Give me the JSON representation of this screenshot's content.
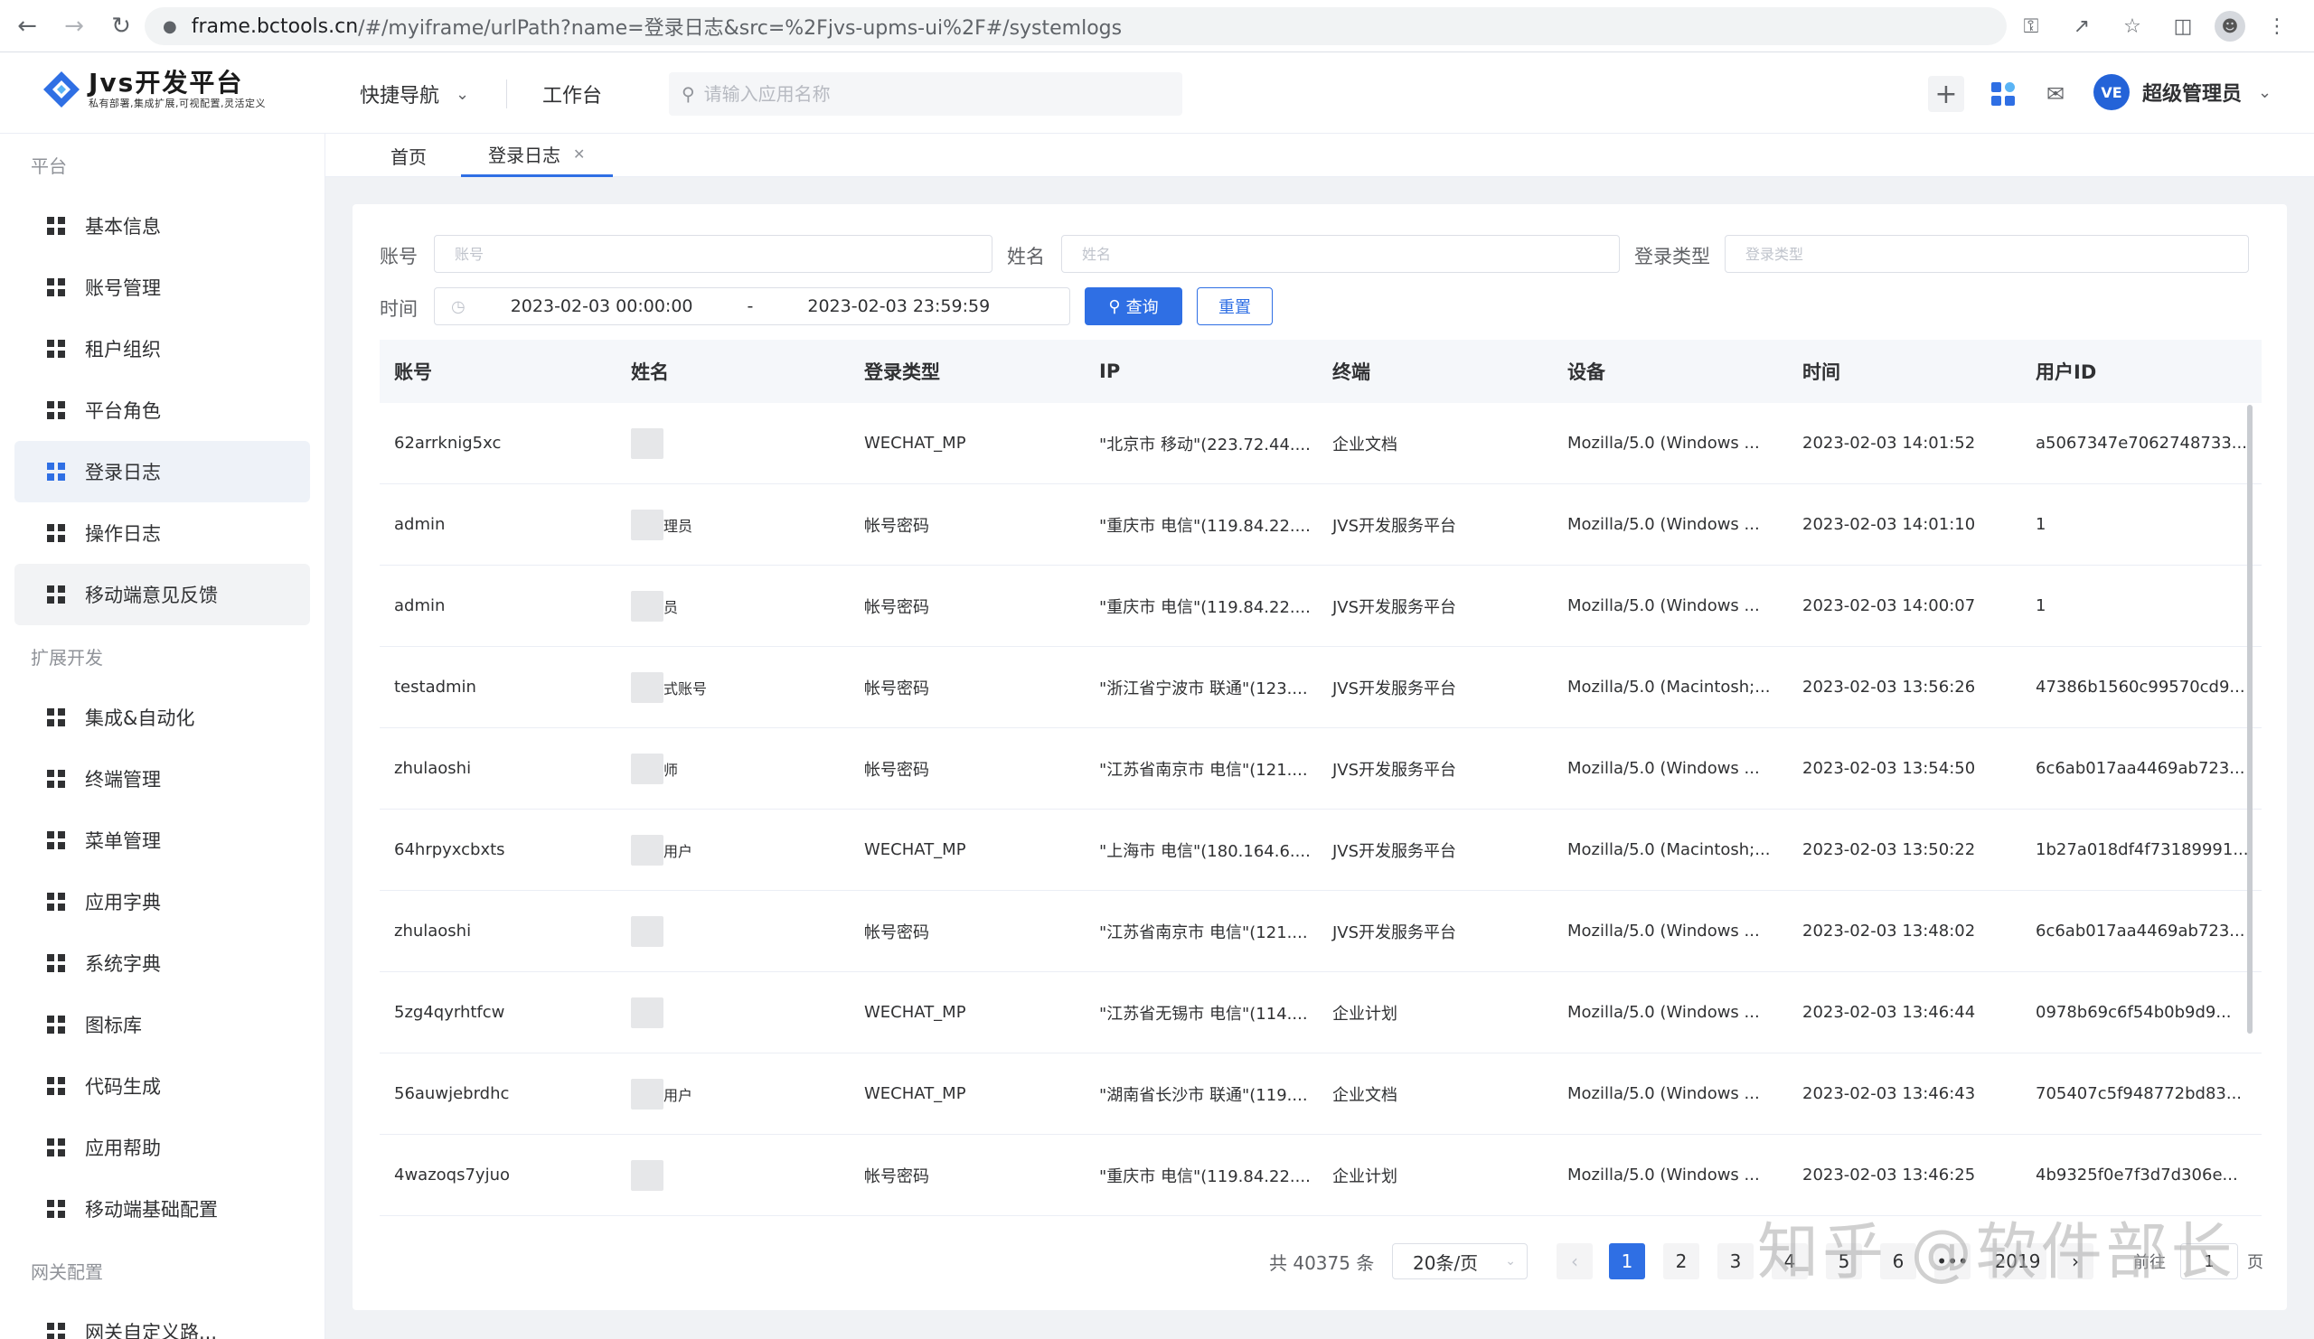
{
  "browser": {
    "host": "frame.bctools.cn",
    "path": "/#/myiframe/urlPath?name=登录日志&src=%2Fjvs-upms-ui%2F#/systemlogs"
  },
  "header": {
    "logo_title": "Jvs开发平台",
    "logo_subtitle": "私有部署,集成扩展,可视配置,灵活定义",
    "quick_nav": "快捷导航",
    "workbench": "工作台",
    "search_placeholder": "请输入应用名称",
    "user_name": "超级管理员",
    "avatar_text": "VE"
  },
  "sidebar": {
    "groups": [
      {
        "title": "平台",
        "items": [
          {
            "label": "基本信息"
          },
          {
            "label": "账号管理"
          },
          {
            "label": "租户组织"
          },
          {
            "label": "平台角色"
          },
          {
            "label": "登录日志"
          },
          {
            "label": "操作日志"
          },
          {
            "label": "移动端意见反馈"
          }
        ]
      },
      {
        "title": "扩展开发",
        "items": [
          {
            "label": "集成&自动化"
          },
          {
            "label": "终端管理"
          },
          {
            "label": "菜单管理"
          },
          {
            "label": "应用字典"
          },
          {
            "label": "系统字典"
          },
          {
            "label": "图标库"
          },
          {
            "label": "代码生成"
          },
          {
            "label": "应用帮助"
          },
          {
            "label": "移动端基础配置"
          }
        ]
      },
      {
        "title": "网关配置",
        "items": [
          {
            "label": "网关自定义路..."
          }
        ]
      }
    ],
    "active_item": "登录日志"
  },
  "tabs": [
    {
      "label": "首页"
    },
    {
      "label": "登录日志"
    }
  ],
  "filters": {
    "account_label": "账号",
    "account_placeholder": "账号",
    "name_label": "姓名",
    "name_placeholder": "姓名",
    "login_type_label": "登录类型",
    "login_type_placeholder": "登录类型",
    "time_label": "时间",
    "time_start": "2023-02-03 00:00:00",
    "time_sep": "-",
    "time_end": "2023-02-03 23:59:59",
    "query_label": "查询",
    "reset_label": "重置"
  },
  "table": {
    "columns": [
      "账号",
      "姓名",
      "登录类型",
      "IP",
      "终端",
      "设备",
      "时间",
      "用户ID"
    ],
    "rows": [
      {
        "account": "62arrknig5xc",
        "name_tail": "",
        "type": "WECHAT_MP",
        "ip": "\"北京市 移动\"(223.72.44....",
        "terminal": "企业文档",
        "device": "Mozilla/5.0 (Windows ...",
        "time": "2023-02-03 14:01:52",
        "uid": "a5067347e7062748733..."
      },
      {
        "account": "admin",
        "name_tail": "理员",
        "type": "帐号密码",
        "ip": "\"重庆市 电信\"(119.84.22....",
        "terminal": "JVS开发服务平台",
        "device": "Mozilla/5.0 (Windows ...",
        "time": "2023-02-03 14:01:10",
        "uid": "1"
      },
      {
        "account": "admin",
        "name_tail": "员",
        "type": "帐号密码",
        "ip": "\"重庆市 电信\"(119.84.22....",
        "terminal": "JVS开发服务平台",
        "device": "Mozilla/5.0 (Windows ...",
        "time": "2023-02-03 14:00:07",
        "uid": "1"
      },
      {
        "account": "testadmin",
        "name_tail": "式账号",
        "type": "帐号密码",
        "ip": "\"浙江省宁波市 联通\"(123....",
        "terminal": "JVS开发服务平台",
        "device": "Mozilla/5.0 (Macintosh;...",
        "time": "2023-02-03 13:56:26",
        "uid": "47386b1560c99570cd9..."
      },
      {
        "account": "zhulaoshi",
        "name_tail": "师",
        "type": "帐号密码",
        "ip": "\"江苏省南京市 电信\"(121....",
        "terminal": "JVS开发服务平台",
        "device": "Mozilla/5.0 (Windows ...",
        "time": "2023-02-03 13:54:50",
        "uid": "6c6ab017aa4469ab723..."
      },
      {
        "account": "64hrpyxcbxts",
        "name_tail": "用户",
        "type": "WECHAT_MP",
        "ip": "\"上海市 电信\"(180.164.6....",
        "terminal": "JVS开发服务平台",
        "device": "Mozilla/5.0 (Macintosh;...",
        "time": "2023-02-03 13:50:22",
        "uid": "1b27a018df4f73189991..."
      },
      {
        "account": "zhulaoshi",
        "name_tail": "",
        "type": "帐号密码",
        "ip": "\"江苏省南京市 电信\"(121....",
        "terminal": "JVS开发服务平台",
        "device": "Mozilla/5.0 (Windows ...",
        "time": "2023-02-03 13:48:02",
        "uid": "6c6ab017aa4469ab723..."
      },
      {
        "account": "5zg4qyrhtfcw",
        "name_tail": "",
        "type": "WECHAT_MP",
        "ip": "\"江苏省无锡市 电信\"(114....",
        "terminal": "企业计划",
        "device": "Mozilla/5.0 (Windows ...",
        "time": "2023-02-03 13:46:44",
        "uid": "0978b69c6f54b0b9d9..."
      },
      {
        "account": "56auwjebrdhc",
        "name_tail": "用户",
        "type": "WECHAT_MP",
        "ip": "\"湖南省长沙市 联通\"(119....",
        "terminal": "企业文档",
        "device": "Mozilla/5.0 (Windows ...",
        "time": "2023-02-03 13:46:43",
        "uid": "705407c5f948772bd83..."
      },
      {
        "account": "4wazoqs7yjuo",
        "name_tail": "",
        "type": "帐号密码",
        "ip": "\"重庆市 电信\"(119.84.22....",
        "terminal": "企业计划",
        "device": "Mozilla/5.0 (Windows ...",
        "time": "2023-02-03 13:46:25",
        "uid": "4b9325f0e7f3d7d306e..."
      }
    ]
  },
  "pagination": {
    "total": "共 40375 条",
    "page_size": "20条/页",
    "pages": [
      "1",
      "2",
      "3",
      "4",
      "5",
      "6",
      "•••",
      "2019"
    ],
    "current": "1",
    "goto_label": "前往",
    "goto_value": "1",
    "goto_suffix": "页"
  },
  "watermark": "知乎 @软件部长",
  "colors": {
    "primary": "#2f6fe4",
    "sidebar_active_bg": "#eef2f8",
    "table_header_bg": "#f5f7fa"
  }
}
